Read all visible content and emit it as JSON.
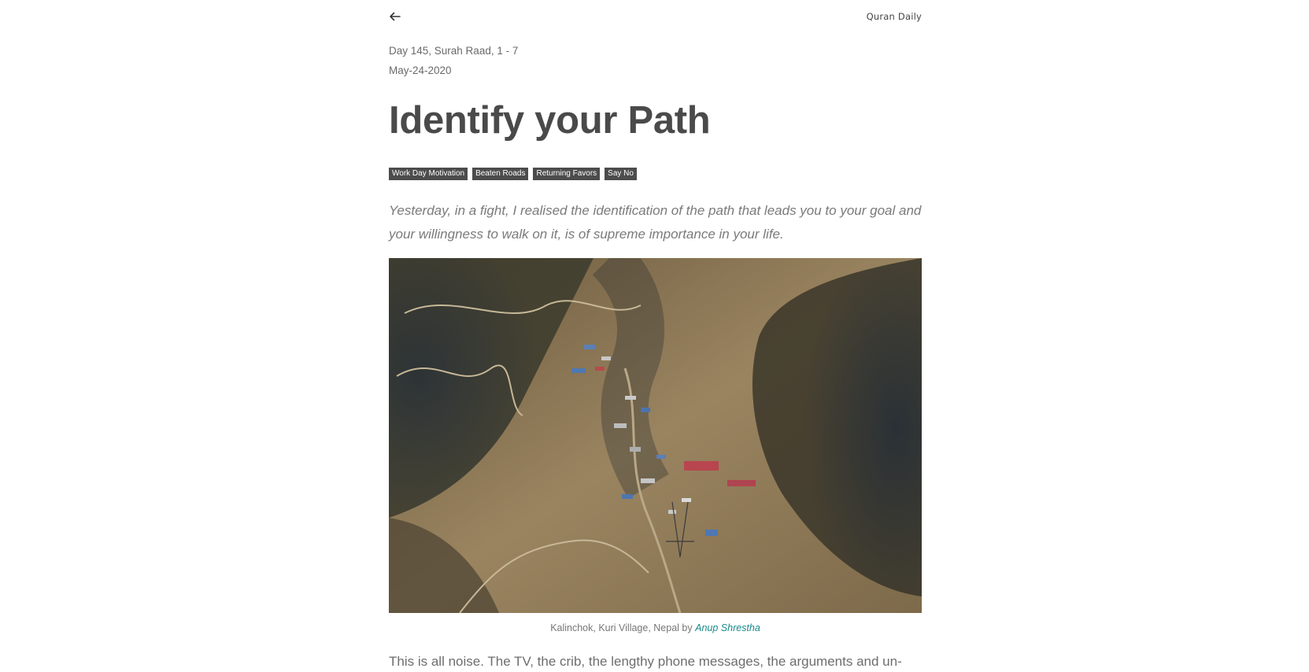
{
  "header": {
    "back_icon": "arrow-left-icon",
    "brand": "Quran Daily"
  },
  "article": {
    "day_info": "Day 145, Surah Raad, 1 - 7",
    "date": "May-24-2020",
    "title": "Identify your Path",
    "tags": [
      "Work Day Motivation",
      "Beaten Roads",
      "Returning Favors",
      "Say No"
    ],
    "lede": "Yesterday, in a fight, I realised the identification of the path that leads you to your goal and your willingness to walk on it, is of supreme importance in your life.",
    "image_caption_prefix": "Kalinchok, Kuri Village, Nepal by",
    "image_credit": "Anup Shrestha",
    "body_first_line": "This is all noise. The TV, the crib, the lengthy phone messages, the arguments and un-"
  },
  "colors": {
    "text": "#555555",
    "tag_bg": "#4c4c4c",
    "link": "#1a8a8a"
  }
}
